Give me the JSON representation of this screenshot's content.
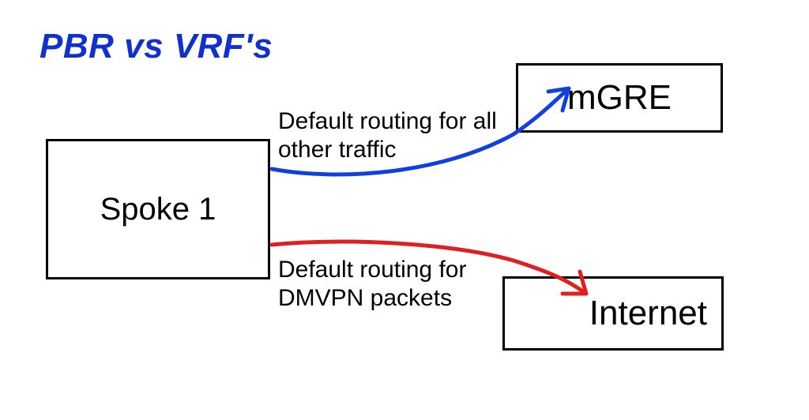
{
  "title": "PBR vs VRF's",
  "nodes": {
    "spoke": "Spoke 1",
    "mgre": "mGRE",
    "internet": "Internet"
  },
  "captions": {
    "top": "Default routing for all\nother traffic",
    "bottom": "Default routing for\nDMVPN packets"
  },
  "colors": {
    "title": "#1030d0",
    "arrow_top": "#1040e0",
    "arrow_bottom": "#e02020"
  }
}
